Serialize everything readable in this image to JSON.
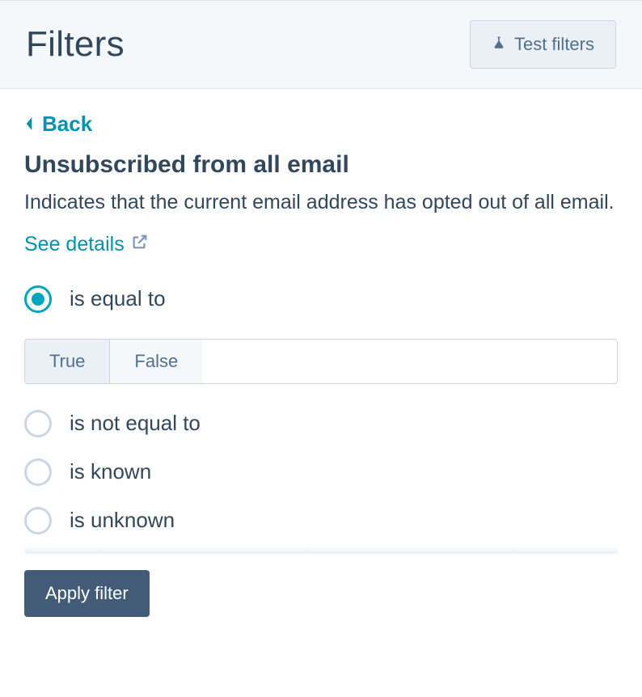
{
  "header": {
    "title": "Filters",
    "test_button": "Test filters"
  },
  "back_label": "Back",
  "filter": {
    "title": "Unsubscribed from all email",
    "description": "Indicates that the current email address has opted out of all email.",
    "details_link": "See details"
  },
  "options": {
    "is_equal_to": "is equal to",
    "is_not_equal_to": "is not equal to",
    "is_known": "is known",
    "is_unknown": "is unknown"
  },
  "bool_toggle": {
    "true_label": "True",
    "false_label": "False"
  },
  "apply_label": "Apply filter"
}
